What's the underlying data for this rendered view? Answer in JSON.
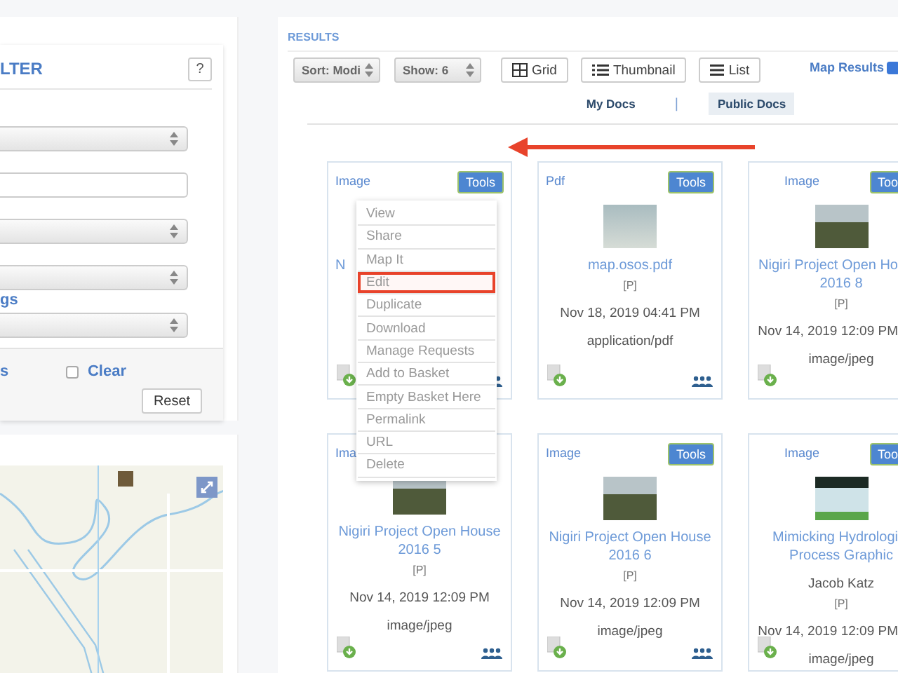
{
  "filter_panel": {
    "title": "LTER",
    "help_button": "?",
    "fields": [
      {
        "kind": "select"
      },
      {
        "kind": "input"
      },
      {
        "kind": "select"
      },
      {
        "kind": "select"
      },
      {
        "kind": "label",
        "text": "gs"
      },
      {
        "kind": "select"
      }
    ],
    "link": "s",
    "clear_checkbox": {
      "label": "Clear",
      "checked": false
    },
    "reset_button": "Reset"
  },
  "results": {
    "title": "RESULTS",
    "sort": "Sort: Modi",
    "show": "Show: 6",
    "view_buttons": [
      {
        "kind": "grid",
        "label": "Grid"
      },
      {
        "kind": "thumbnail",
        "label": "Thumbnail"
      },
      {
        "kind": "list",
        "label": "List"
      }
    ],
    "map_results": {
      "label": "Map Results",
      "checked": true
    },
    "tabs": [
      {
        "label": "My Docs",
        "selected": false
      },
      {
        "label": "Public Docs",
        "selected": true
      }
    ],
    "tab_separator": "|",
    "documents": [
      {
        "type": "Image",
        "tools": "Tools",
        "title": [
          "N"
        ]
      },
      {
        "type": "Pdf",
        "tools": "Tools",
        "thumbnail": {
          "kind": "map"
        },
        "title": [
          "map.osos.pdf"
        ],
        "lines": [
          "[P]",
          "Nov 18, 2019 04:41 PM",
          "application/pdf"
        ]
      },
      {
        "type": "Image",
        "tools": "Too",
        "thumbnail": {
          "kind": "photo"
        },
        "title": [
          "Nigiri Project Open Ho",
          "2016 8"
        ],
        "lines": [
          "[P]",
          "Nov 14, 2019 12:09 PM",
          "image/jpeg"
        ]
      },
      {
        "type": "Ima",
        "thumbnail": {
          "kind": "photo"
        },
        "title": [
          "Nigiri Project Open House",
          "2016 5"
        ],
        "lines": [
          "[P]",
          "Nov 14, 2019 12:09 PM",
          "image/jpeg"
        ]
      },
      {
        "type": "Image",
        "tools": "Tools",
        "thumbnail": {
          "kind": "photo"
        },
        "title": [
          "Nigiri Project Open House",
          "2016 6"
        ],
        "lines": [
          "[P]",
          "Nov 14, 2019 12:09 PM",
          "image/jpeg"
        ]
      },
      {
        "type": "Image",
        "tools": "Too",
        "thumbnail": {
          "kind": "graphic"
        },
        "title": [
          "Mimicking Hydrologi",
          "Process Graphic"
        ],
        "lines": [
          "Jacob Katz",
          "[P]",
          "Nov 14, 2019 12:09 PM",
          "image/jpeg"
        ]
      }
    ],
    "tools_menu": {
      "items": [
        {
          "label": "View",
          "highlighted": false
        },
        {
          "label": "Share",
          "highlighted": false
        },
        {
          "label": "Map It",
          "highlighted": false
        },
        {
          "label": "Edit",
          "highlighted": true
        },
        {
          "label": "Duplicate",
          "highlighted": false
        },
        {
          "label": "Download",
          "highlighted": false
        },
        {
          "label": "Manage Requests",
          "highlighted": false
        },
        {
          "label": "Add to Basket",
          "highlighted": false
        },
        {
          "label": "Empty Basket Here",
          "highlighted": false
        },
        {
          "label": "Permalink",
          "highlighted": false
        },
        {
          "label": "URL",
          "highlighted": false
        },
        {
          "label": "Delete",
          "highlighted": false
        }
      ]
    },
    "annotations": [
      {
        "kind": "arrow"
      }
    ]
  }
}
